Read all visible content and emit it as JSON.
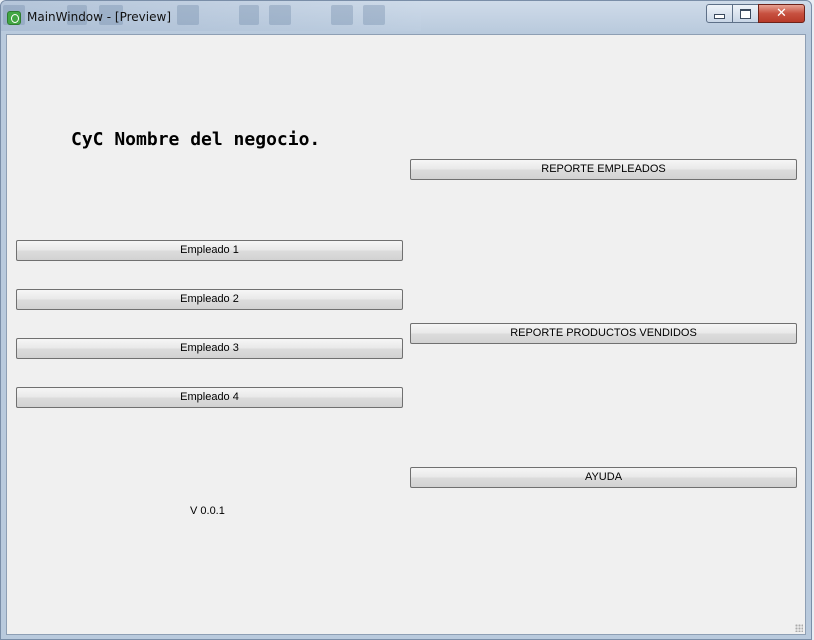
{
  "window": {
    "title": "MainWindow - [Preview]",
    "close_glyph": "✕"
  },
  "main": {
    "business_name": "CyC Nombre del negocio.",
    "version": "V 0.0.1",
    "employee_buttons": [
      "Empleado 1",
      "Empleado 2",
      "Empleado 3",
      "Empleado 4"
    ],
    "report_employees_label": "REPORTE EMPLEADOS",
    "report_products_label": "REPORTE PRODUCTOS VENDIDOS",
    "help_label": "AYUDA"
  },
  "icons": {
    "app": "qt-designer-icon",
    "minimize": "minimize-icon",
    "maximize": "maximize-icon",
    "close": "close-icon"
  },
  "colors": {
    "client_background": "#f0f0f0",
    "titlebar": "#b9cadd",
    "close_button": "#c75140"
  }
}
